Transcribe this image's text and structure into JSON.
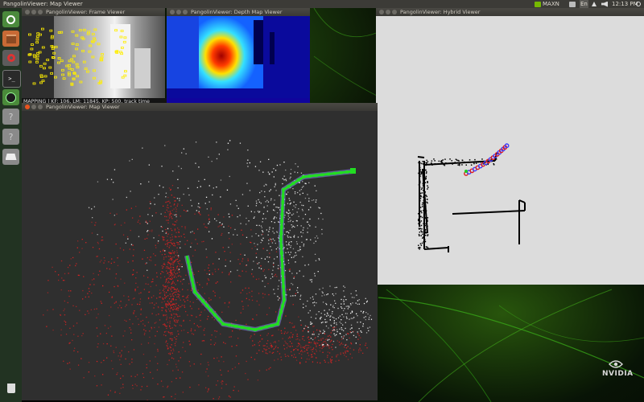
{
  "topbar": {
    "active_window_title": "PangolinViewer: Map Viewer",
    "power_mode": "MAXN",
    "keyboard_layout": "En",
    "clock": "12:13 PM"
  },
  "launcher": {
    "items": [
      {
        "icon": "ubuntu-dash-icon"
      },
      {
        "icon": "file-manager-icon"
      },
      {
        "icon": "system-settings-icon"
      },
      {
        "icon": "terminal-icon"
      },
      {
        "icon": "nvidia-control-icon"
      },
      {
        "icon": "unknown-app-icon"
      },
      {
        "icon": "unknown-app-icon"
      },
      {
        "icon": "drive-icon"
      },
      {
        "icon": "trash-icon"
      }
    ]
  },
  "windows": {
    "frame_viewer": {
      "title": "PangolinViewer: Frame Viewer",
      "status": "MAPPING | KF: 106, LM: 11845, KP: 500, track time"
    },
    "depth_map_viewer": {
      "title": "PangolinViewer: Depth Map Viewer"
    },
    "hybrid_viewer": {
      "title": "PangolinViewer: Hybrid Viewer"
    },
    "map_viewer": {
      "title": "PangolinViewer: Map Viewer"
    }
  },
  "wallpaper": {
    "brand": "NVIDIA"
  },
  "colors": {
    "trajectory": "#22dd22",
    "landmarks_local": "#dd2222",
    "landmarks_global": "#ffffff",
    "keypoints": "#ffee00"
  }
}
